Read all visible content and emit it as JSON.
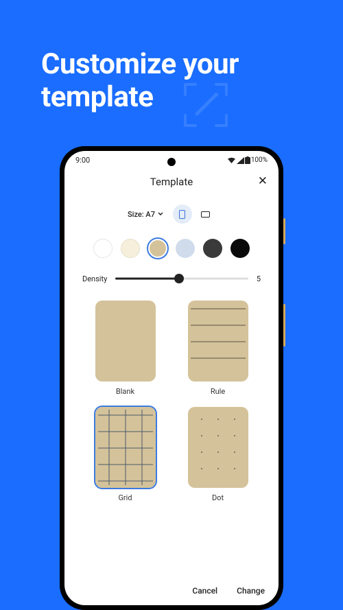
{
  "hero": {
    "title_line1": "Customize your",
    "title_line2": "template"
  },
  "statusbar": {
    "time": "9:00",
    "battery_text": "100%"
  },
  "screen": {
    "title": "Template",
    "size_label": "Size: A7",
    "orientation": {
      "selected": "portrait"
    },
    "colors": [
      {
        "name": "white",
        "hex": "#ffffff",
        "border": "#e5e5e5"
      },
      {
        "name": "cream",
        "hex": "#f5efdc",
        "border": "#e5dfc8"
      },
      {
        "name": "tan",
        "hex": "#d4c29a",
        "border": "#d4c29a",
        "selected": true
      },
      {
        "name": "light-blue",
        "hex": "#d0dcec",
        "border": "#d0dcec"
      },
      {
        "name": "charcoal",
        "hex": "#3a3a3a",
        "border": "#3a3a3a"
      },
      {
        "name": "black",
        "hex": "#0a0a0a",
        "border": "#0a0a0a"
      }
    ],
    "density": {
      "label": "Density",
      "value": "5",
      "fill_pct": 48,
      "thumb_pct": 48
    },
    "templates": [
      {
        "key": "blank",
        "label": "Blank",
        "bg": "#d4c29a"
      },
      {
        "key": "rule",
        "label": "Rule",
        "bg": "#d4c29a"
      },
      {
        "key": "grid",
        "label": "Grid",
        "bg": "#d4c29a",
        "selected": true
      },
      {
        "key": "dot",
        "label": "Dot",
        "bg": "#d4c29a"
      }
    ],
    "footer": {
      "cancel": "Cancel",
      "change": "Change"
    }
  }
}
